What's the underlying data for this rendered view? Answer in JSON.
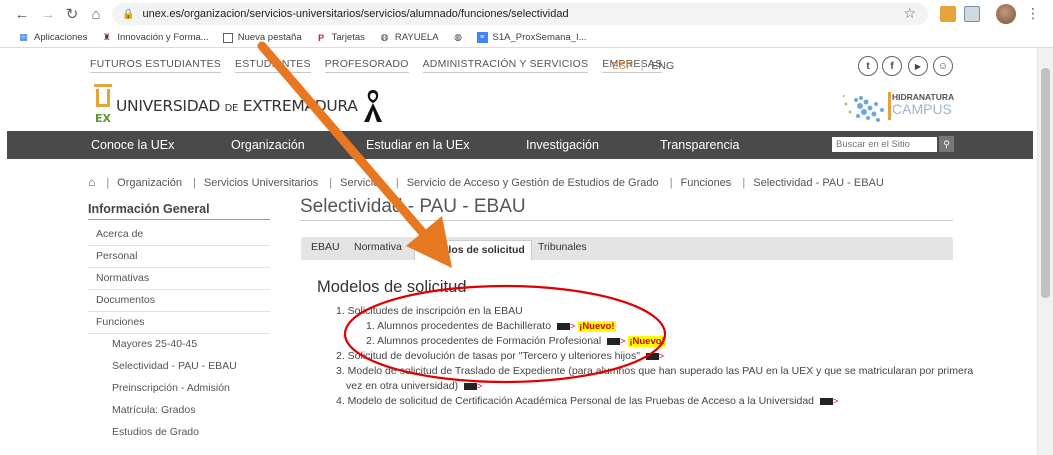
{
  "browser": {
    "url": "unex.es/organizacion/servicios-universitarios/servicios/alumnado/funciones/selectividad",
    "bookmarks": [
      "Aplicaciones",
      "Innovación y Forma...",
      "Nueva pestaña",
      "Tarjetas",
      "RAYUELA",
      "S1A_ProxSemana_I..."
    ]
  },
  "site": {
    "top_links": [
      "FUTUROS ESTUDIANTES",
      "ESTUDIANTES",
      "PROFESORADO",
      "ADMINISTRACIÓN Y SERVICIOS",
      "EMPRESAS"
    ],
    "lang_esp": "ESP",
    "lang_eng": "ENG",
    "logo_ex": "EX",
    "logo_universidad": "UNIVERSIDAD",
    "logo_de": "DE",
    "logo_extremadura": "EXTREMADURA",
    "campus_line1": "HIDRANATURA",
    "campus_line2": "CAMPUS",
    "main_nav": [
      "Conoce la UEx",
      "Organización",
      "Estudiar en la UEx",
      "Investigación",
      "Transparencia"
    ],
    "search_placeholder": "Buscar en el Sitio"
  },
  "breadcrumb": [
    "Organización",
    "Servicios Universitarios",
    "Servicios",
    "Servicio de Acceso y Gestión de Estudios de Grado",
    "Funciones",
    "Selectividad - PAU - EBAU"
  ],
  "sidebar": {
    "title": "Información General",
    "items": [
      "Acerca de",
      "Personal",
      "Normativas",
      "Documentos",
      "Funciones"
    ],
    "subitems": [
      "Mayores 25-40-45",
      "Selectividad - PAU - EBAU",
      "Preinscripción - Admisión",
      "Matrícula: Grados",
      "Estudios de Grado"
    ]
  },
  "page": {
    "title": "Selectividad - PAU - EBAU",
    "tabs": [
      "EBAU",
      "Normativa",
      "Modelos de solicitud",
      "Tribunales"
    ],
    "active_tab": "Modelos de solicitud",
    "content_title": "Modelos de solicitud",
    "list": {
      "i1": "1. Solicitudes de inscripción en la EBAU",
      "i1a": "1. Alumnos procedentes de Bachillerato",
      "i1b": "2. Alumnos procedentes de Formación Profesional",
      "i2": "2. Solicitud de devolución de tasas por \"Tercero y ulteriores hijos\"",
      "i3a": "3. Modelo de solicitud de Traslado de Expediente (para alumnos que han superado las PAU en la UEX y que se matricularan por primera",
      "i3b": "vez en otra universidad)",
      "i4": "4. Modelo de solicitud de Certificación Académica Personal de las Pruebas de Acceso a la Universidad"
    },
    "nuevo_badge": "¡Nuevo!"
  },
  "colors": {
    "accent_orange": "#e87722",
    "annotation_red": "#e00000",
    "nav_bg": "#4a4a4a"
  }
}
